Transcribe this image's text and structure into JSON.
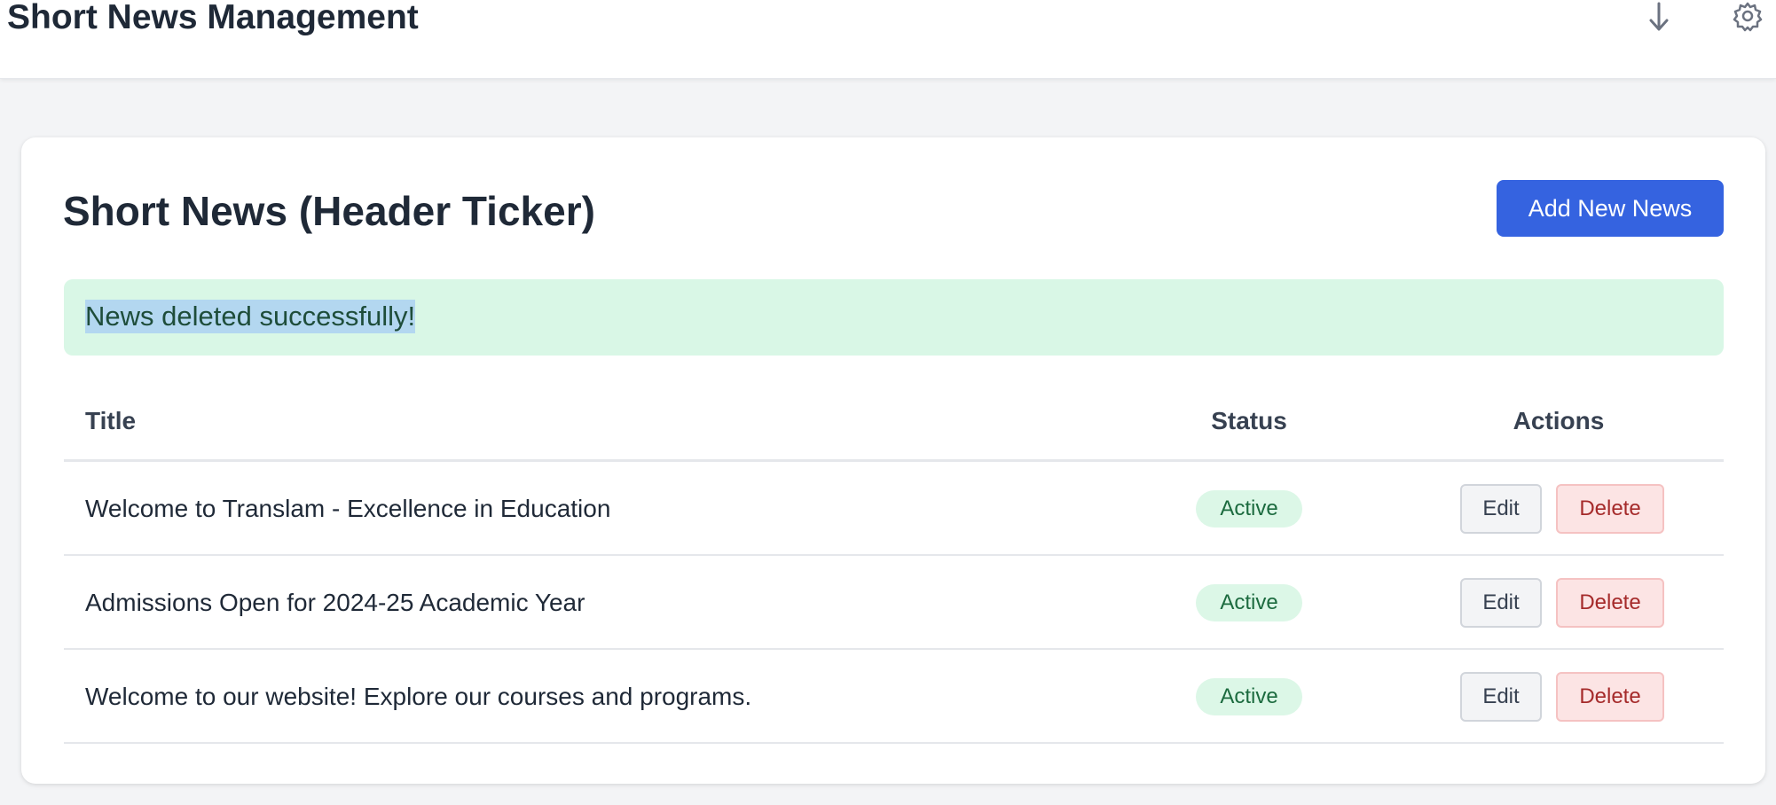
{
  "header": {
    "title": "Short News Management",
    "icons": [
      "download-icon",
      "settings-icon"
    ]
  },
  "card": {
    "title": "Short News (Header Ticker)",
    "add_button_label": "Add New News"
  },
  "alert": {
    "message": "News deleted successfully!"
  },
  "table": {
    "columns": [
      "Title",
      "Status",
      "Actions"
    ],
    "rows": [
      {
        "title": "Welcome to Translam - Excellence in Education",
        "status": "Active",
        "edit_label": "Edit",
        "delete_label": "Delete"
      },
      {
        "title": "Admissions Open for 2024-25 Academic Year",
        "status": "Active",
        "edit_label": "Edit",
        "delete_label": "Delete"
      },
      {
        "title": "Welcome to our website! Explore our courses and programs.",
        "status": "Active",
        "edit_label": "Edit",
        "delete_label": "Delete"
      }
    ]
  },
  "colors": {
    "primary": "#3563e0",
    "success_bg": "#d9f7e6",
    "badge_bg": "#dcf7e7",
    "badge_text": "#1c6b3f",
    "delete_bg": "#fce4e4",
    "delete_text": "#a52a2a"
  }
}
